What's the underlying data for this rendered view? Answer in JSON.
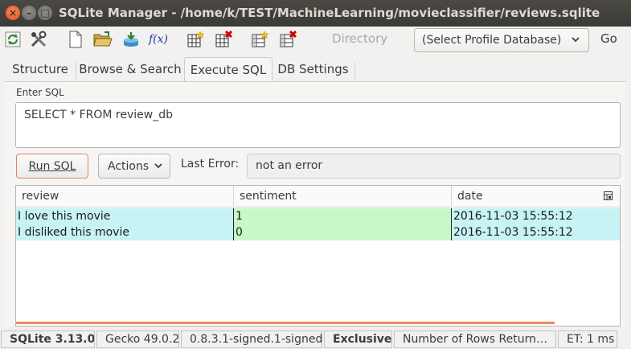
{
  "window": {
    "title": "SQLite Manager - /home/k/TEST/MachineLearning/movieclassifier/reviews.sqlite",
    "close_glyph": "×",
    "minimize_glyph": "–",
    "maximize_glyph": "□"
  },
  "toolbar": {
    "function_label": "f(x)",
    "directory_label": "Directory",
    "profile_select_value": "(Select Profile Database)",
    "go_label": "Go"
  },
  "tabs": [
    {
      "label": "Structure",
      "active": false
    },
    {
      "label": "Browse & Search",
      "active": false
    },
    {
      "label": "Execute SQL",
      "active": true
    },
    {
      "label": "DB Settings",
      "active": false
    }
  ],
  "execute_sql": {
    "enter_sql_label": "Enter SQL",
    "sql_text": "SELECT * FROM review_db",
    "run_button_label": "Run SQL",
    "actions_label": "Actions",
    "last_error_label": "Last Error:",
    "last_error_value": "not an error"
  },
  "results": {
    "columns": [
      "review",
      "sentiment",
      "date"
    ],
    "rows": [
      [
        "I love this movie",
        "1",
        "2016-11-03 15:55:12"
      ],
      [
        "I disliked this movie",
        "0",
        "2016-11-03 15:55:12"
      ]
    ]
  },
  "statusbar": {
    "sqlite_version": "SQLite 3.13.0",
    "gecko_version": "Gecko 49.0.2",
    "extension_version": "0.8.3.1-signed.1-signed",
    "lock_mode": "Exclusive",
    "rows_returned": "Number of Rows Return…",
    "elapsed_time": "ET: 1 ms"
  },
  "colors": {
    "titlebar": "#3b3a36",
    "close_button": "#e1521b",
    "accent_orange": "#f08a5d",
    "row_cyan": "#c7f3f5",
    "row_green": "#c7f8c7"
  }
}
